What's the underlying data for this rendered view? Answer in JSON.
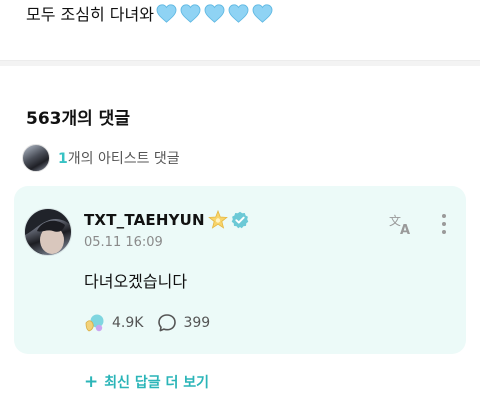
{
  "post": {
    "text": "모두 조심히 다녀와",
    "heart_icon": "light-blue-heart-icon",
    "heart_count": 5,
    "heart_color": "#8fd3f4"
  },
  "comments": {
    "count_label": "563개의 댓글",
    "artist_count": "1",
    "artist_label": "개의 아티스트 댓글"
  },
  "comment": {
    "author": "TXT_TAEHYUN",
    "date": "05.11 16:09",
    "body": "다녀오겠습니다",
    "likes": "4.9K",
    "replies": "399",
    "badges": [
      "star-badge-icon",
      "verified-check-icon"
    ],
    "actions": [
      "translate-icon",
      "more-vert-icon"
    ]
  },
  "footer": {
    "more_replies_plus": "+",
    "more_replies_label": "최신 답글 더 보기"
  },
  "colors": {
    "accent": "#2bb5b8",
    "card_bg": "#ecfaf8",
    "verified": "#6cc9d6"
  }
}
